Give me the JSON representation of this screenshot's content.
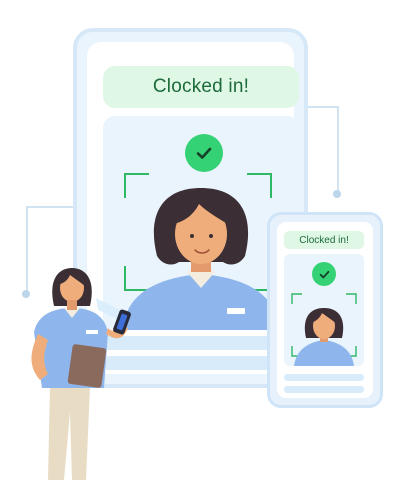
{
  "tablet": {
    "status_label": "Clocked in!",
    "check_icon": "check-icon"
  },
  "phone": {
    "status_label": "Clocked in!",
    "check_icon": "check-icon"
  },
  "colors": {
    "success_green": "#34d274",
    "status_bg": "#dff8e6",
    "status_text": "#1d6a3a",
    "frame_blue": "#d6e8f7"
  }
}
